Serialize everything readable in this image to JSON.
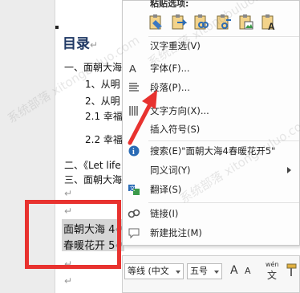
{
  "document": {
    "toc_title": "目录",
    "para_mark": "↵",
    "lines": [
      {
        "id": "l1",
        "text": "一、面朝大海"
      },
      {
        "id": "l2",
        "text": "1、从明"
      },
      {
        "id": "l3",
        "text": "2、从明"
      },
      {
        "id": "l4",
        "text": "2.1  幸福"
      },
      {
        "id": "l5",
        "text": "2.2  幸福"
      },
      {
        "id": "l6",
        "text": "二、《Let life"
      },
      {
        "id": "l7",
        "text": "三、面朝大海"
      }
    ],
    "selected": [
      "面朝大海 4",
      "春暖花开 5"
    ]
  },
  "context_menu": {
    "paste_header": "粘贴选项:",
    "paste_icons": [
      "keep-source-formatting-icon",
      "merge-formatting-icon",
      "link-keep-source-icon",
      "link-merge-icon",
      "picture-icon",
      "keep-text-only-icon"
    ],
    "items": [
      {
        "id": "hanzi-reselect",
        "label": "汉字重选(V)",
        "icon": ""
      },
      {
        "id": "font",
        "label": "字体(F)...",
        "icon": "font-icon"
      },
      {
        "id": "paragraph",
        "label": "段落(P)...",
        "icon": "paragraph-icon"
      },
      {
        "id": "text-direction",
        "label": "文字方向(X)...",
        "icon": "text-direction-icon"
      },
      {
        "id": "insert-symbol",
        "label": "插入符号(S)",
        "icon": ""
      },
      {
        "id": "search",
        "label": "搜索(E)\"面朝大海4春暖花开5\"",
        "icon": "search-icon"
      },
      {
        "id": "synonyms",
        "label": "同义词(Y)",
        "icon": ""
      },
      {
        "id": "translate",
        "label": "翻译(S)",
        "icon": "translate-icon"
      },
      {
        "id": "link",
        "label": "链接(I)",
        "icon": "link-icon"
      },
      {
        "id": "new-comment",
        "label": "新建批注(M)",
        "icon": "comment-icon"
      }
    ]
  },
  "mini_toolbar": {
    "font_name": "等线 (中文",
    "font_size": "五号",
    "grow_font": "A",
    "shrink_font": "A",
    "phonetic_top": "wén",
    "phonetic_bottom": "文"
  },
  "watermark": "系统部落 xitongbuluo.com",
  "colors": {
    "annotation_red": "#e8322f",
    "selection": "#d6d6d6"
  }
}
